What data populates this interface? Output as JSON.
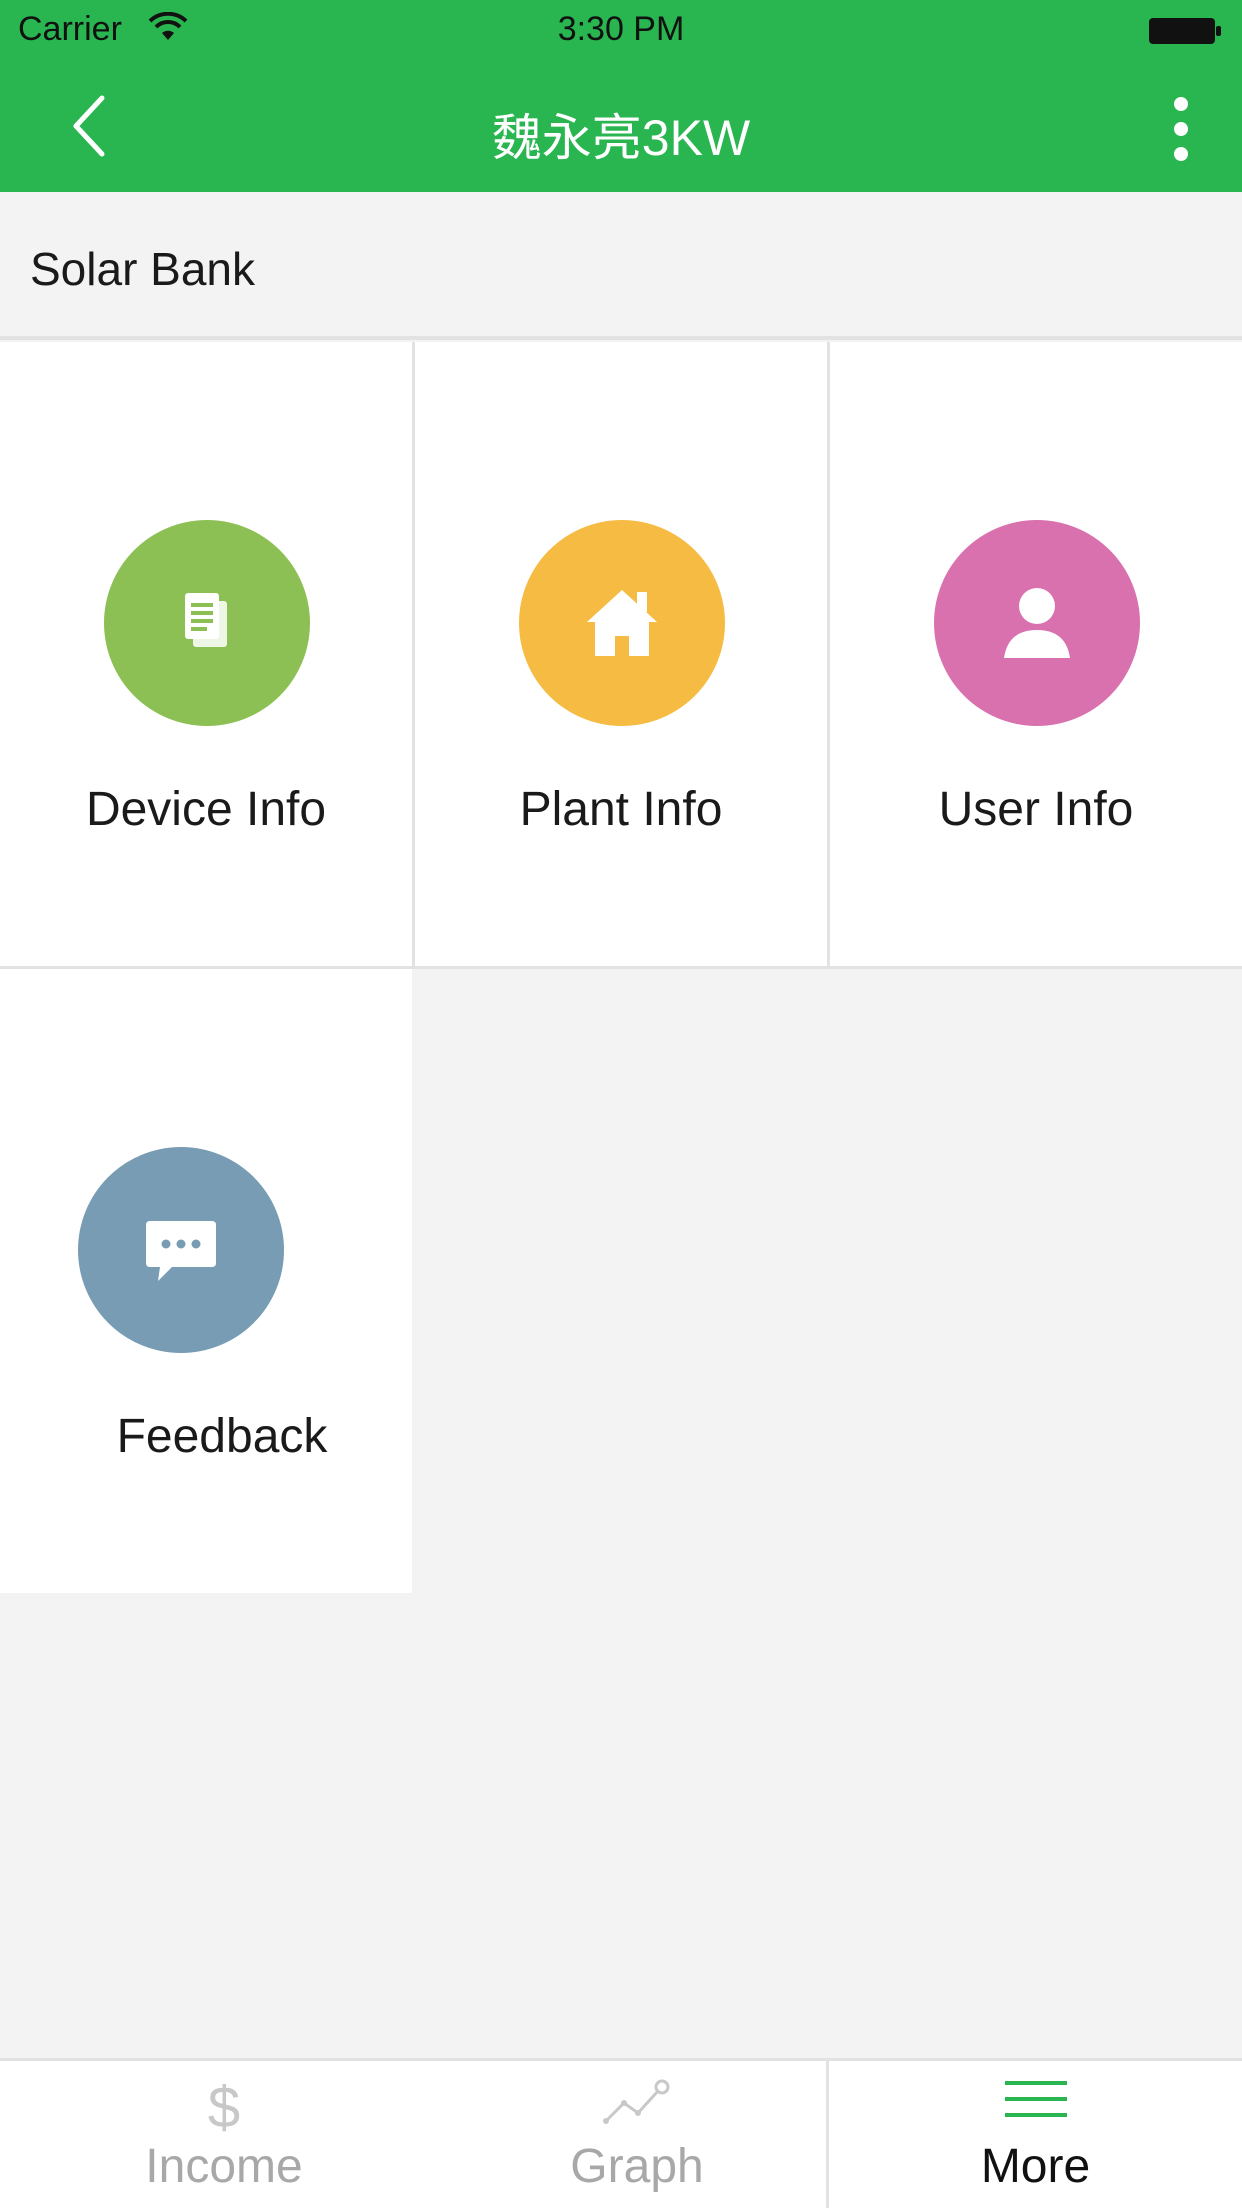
{
  "status_bar": {
    "carrier": "Carrier",
    "time": "3:30 PM",
    "icons": [
      "wifi-icon",
      "battery-icon"
    ]
  },
  "nav": {
    "title": "魏永亮3KW",
    "back_icon": "chevron-left-icon",
    "more_icon": "vertical-ellipsis-icon"
  },
  "section": {
    "title": "Solar Bank"
  },
  "tiles": [
    {
      "label": "Device Info",
      "icon": "document-icon",
      "color": "#8dc054"
    },
    {
      "label": "Plant Info",
      "icon": "home-icon",
      "color": "#f6bb42"
    },
    {
      "label": "User Info",
      "icon": "user-icon",
      "color": "#d871ae"
    },
    {
      "label": "Feedback",
      "icon": "chat-bubble-icon",
      "color": "#789cb3"
    }
  ],
  "tab_bar": {
    "tabs": [
      {
        "label": "Income",
        "icon": "dollar-icon",
        "active": false
      },
      {
        "label": "Graph",
        "icon": "line-chart-icon",
        "active": false
      },
      {
        "label": "More",
        "icon": "menu-icon",
        "active": true
      }
    ],
    "active_color": "#29b54f",
    "inactive_color": "#a8a8a8"
  },
  "colors": {
    "brand_green": "#29b54f",
    "background": "#f3f3f3"
  }
}
